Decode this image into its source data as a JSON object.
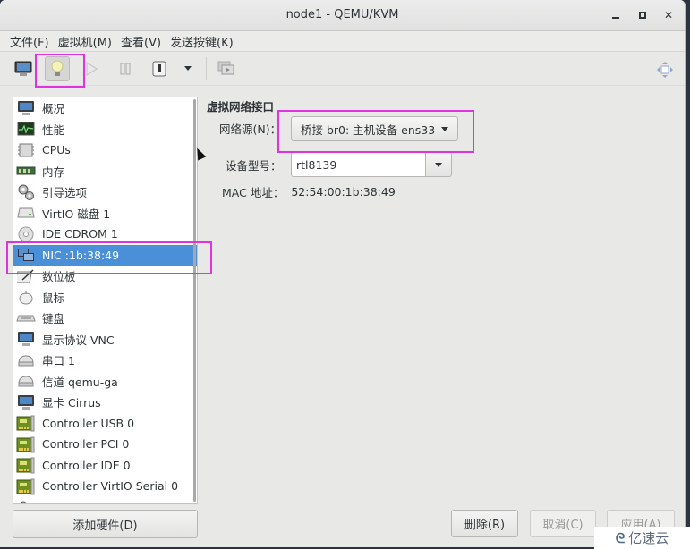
{
  "window": {
    "title": "node1 - QEMU/KVM",
    "controls": {
      "minimize": "minimize",
      "maximize": "maximize",
      "close": "close"
    }
  },
  "menubar": [
    {
      "label": "文件(F)"
    },
    {
      "label": "虚拟机(M)"
    },
    {
      "label": "查看(V)"
    },
    {
      "label": "发送按键(K)"
    }
  ],
  "toolbar": {
    "items": [
      {
        "name": "console-view",
        "icon": "monitor-icon",
        "active": false
      },
      {
        "name": "details-view",
        "icon": "lightbulb-icon",
        "active": true
      },
      {
        "name": "run",
        "icon": "play-icon",
        "enabled": false
      },
      {
        "name": "pause",
        "icon": "pause-icon",
        "enabled": false
      },
      {
        "name": "shutdown",
        "icon": "power-icon",
        "enabled": true
      },
      {
        "name": "shutdown-menu",
        "icon": "dropdown-arrow-icon",
        "enabled": true
      },
      {
        "name": "snapshots",
        "icon": "snapshots-icon",
        "enabled": false
      }
    ],
    "fullscreen_icon": "fullscreen-icon"
  },
  "sidebar": {
    "selected_index": 7,
    "items": [
      {
        "label": "概况",
        "icon": "monitor-icon"
      },
      {
        "label": "性能",
        "icon": "performance-icon"
      },
      {
        "label": "CPUs",
        "icon": "cpu-icon"
      },
      {
        "label": "内存",
        "icon": "memory-icon"
      },
      {
        "label": "引导选项",
        "icon": "gears-icon"
      },
      {
        "label": "VirtIO 磁盘 1",
        "icon": "disk-icon"
      },
      {
        "label": "IDE CDROM 1",
        "icon": "cdrom-icon"
      },
      {
        "label": "NIC :1b:38:49",
        "icon": "network-icon"
      },
      {
        "label": "数位板",
        "icon": "tablet-icon"
      },
      {
        "label": "鼠标",
        "icon": "mouse-icon"
      },
      {
        "label": "键盘",
        "icon": "keyboard-icon"
      },
      {
        "label": "显示协议 VNC",
        "icon": "monitor-icon"
      },
      {
        "label": "串口 1",
        "icon": "serial-icon"
      },
      {
        "label": "信道 qemu-ga",
        "icon": "serial-icon"
      },
      {
        "label": "显卡 Cirrus",
        "icon": "monitor-icon"
      },
      {
        "label": "Controller USB 0",
        "icon": "controller-card-icon"
      },
      {
        "label": "Controller PCI 0",
        "icon": "controller-card-icon"
      },
      {
        "label": "Controller IDE 0",
        "icon": "controller-card-icon"
      },
      {
        "label": "Controller VirtIO Serial 0",
        "icon": "controller-card-icon"
      },
      {
        "label": "随机数生成器 /dev/urandom",
        "icon": "rng-icon"
      }
    ],
    "add_hardware_label": "添加硬件(D)"
  },
  "details": {
    "section_title": "虚拟网络接口",
    "network_source_label": "网络源(N)：",
    "network_source_value": "桥接 br0: 主机设备 ens33",
    "device_model_label": "设备型号：",
    "device_model_value": "rtl8139",
    "mac_label": "MAC 地址：",
    "mac_value": "52:54:00:1b:38:49"
  },
  "buttons": {
    "remove": "删除(R)",
    "cancel": "取消(C)",
    "apply": "应用(A)"
  },
  "watermark": {
    "logo": "ᘓ",
    "text": "亿速云"
  },
  "colors": {
    "selection": "#4a90d9",
    "highlight_box": "#e033e0"
  }
}
